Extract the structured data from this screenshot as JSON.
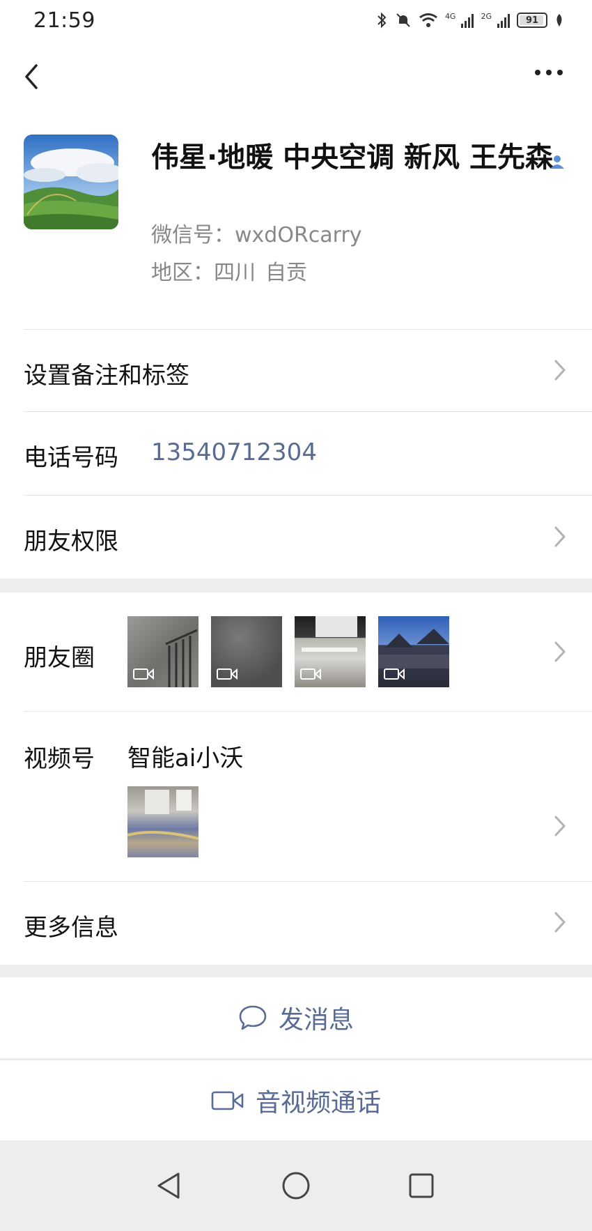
{
  "status_bar": {
    "time": "21:59",
    "net1": "4G",
    "net2": "2G",
    "battery": "91"
  },
  "profile": {
    "name": "伟星·地暖 中央空调 新风 王先森",
    "wechat_id": "微信号：wxdORcarry",
    "region_label": "地区：",
    "region_province": "四川",
    "region_city": "自贡"
  },
  "rows": {
    "remark_label": "设置备注和标签",
    "phone_label": "电话号码",
    "phone_value": "13540712304",
    "permission_label": "朋友权限",
    "moments_label": "朋友圈",
    "channels_label": "视频号",
    "channels_name": "智能ai小沃",
    "more_label": "更多信息"
  },
  "actions": {
    "message": "发消息",
    "call": "音视频通话"
  },
  "colors": {
    "link": "#576b95",
    "background": "#ededed",
    "verified": "#5b8fd6"
  }
}
